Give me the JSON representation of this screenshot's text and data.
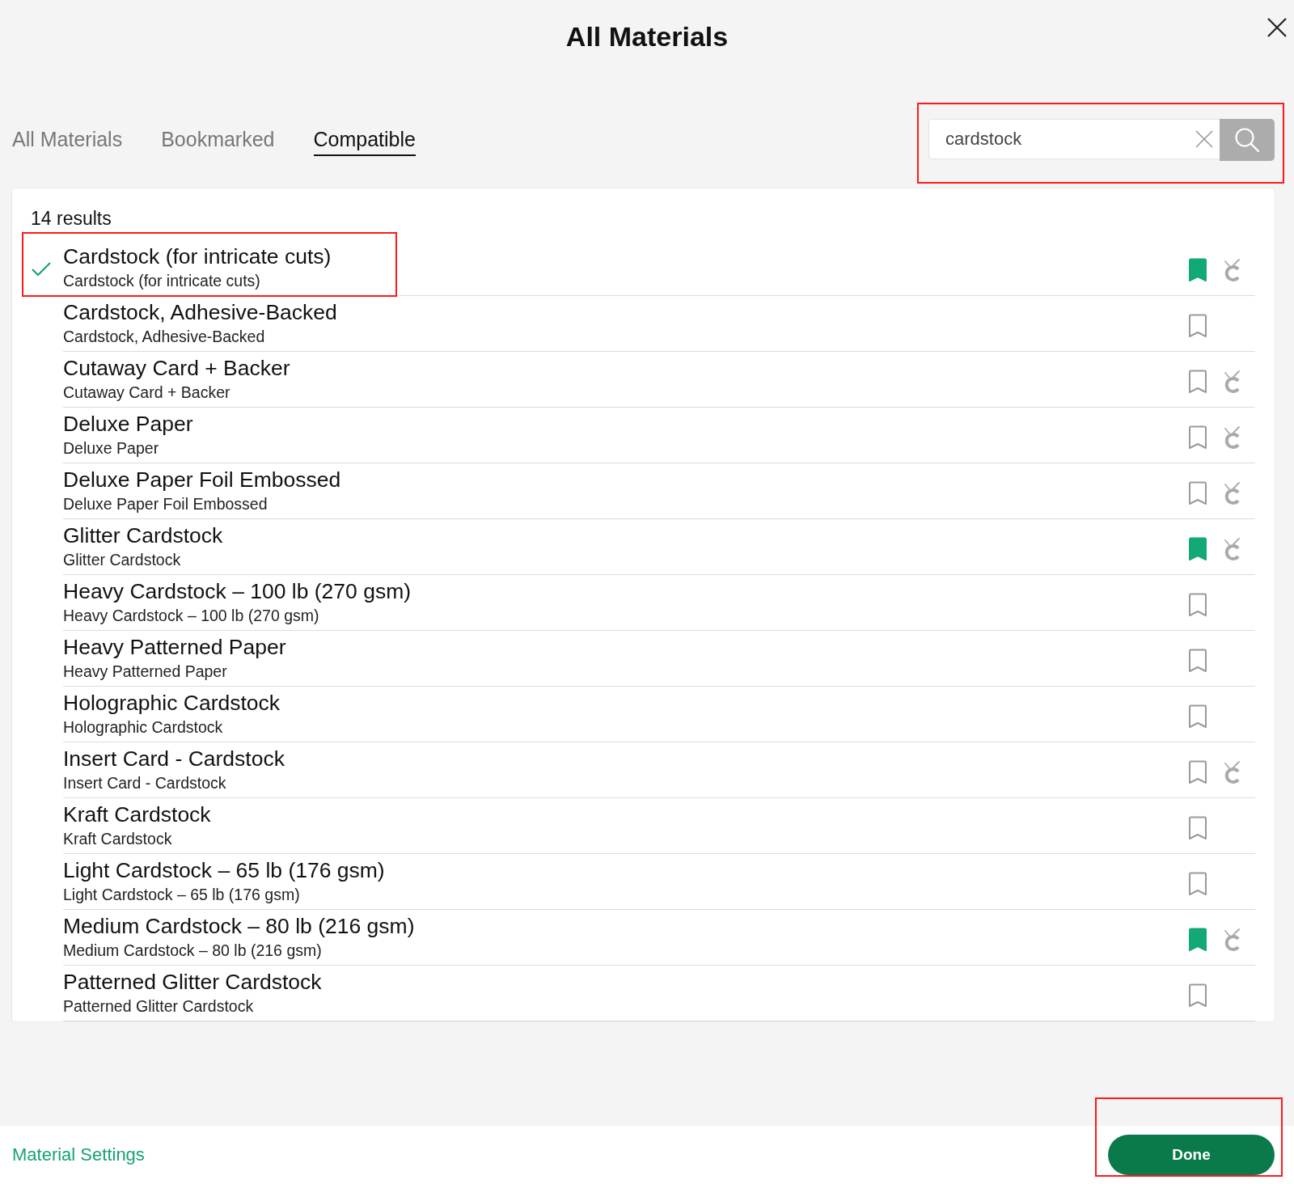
{
  "window": {
    "title": "All Materials"
  },
  "tabs": [
    {
      "label": "All Materials",
      "selected": false
    },
    {
      "label": "Bookmarked",
      "selected": false
    },
    {
      "label": "Compatible",
      "selected": true
    }
  ],
  "search": {
    "value": "cardstock",
    "highlighted": true
  },
  "results_count": "14 results",
  "materials": [
    {
      "title": "Cardstock (for intricate cuts)",
      "subtitle": "Cardstock (for intricate cuts)",
      "selected": true,
      "bookmarked": true,
      "machine_compatible": true,
      "highlighted": true
    },
    {
      "title": "Cardstock, Adhesive-Backed",
      "subtitle": "Cardstock, Adhesive-Backed",
      "selected": false,
      "bookmarked": false,
      "machine_compatible": false,
      "highlighted": false
    },
    {
      "title": "Cutaway Card + Backer",
      "subtitle": "Cutaway Card + Backer",
      "selected": false,
      "bookmarked": false,
      "machine_compatible": true,
      "highlighted": false
    },
    {
      "title": "Deluxe Paper",
      "subtitle": "Deluxe Paper",
      "selected": false,
      "bookmarked": false,
      "machine_compatible": true,
      "highlighted": false
    },
    {
      "title": "Deluxe Paper Foil Embossed",
      "subtitle": "Deluxe Paper Foil Embossed",
      "selected": false,
      "bookmarked": false,
      "machine_compatible": true,
      "highlighted": false
    },
    {
      "title": "Glitter Cardstock",
      "subtitle": "Glitter Cardstock",
      "selected": false,
      "bookmarked": true,
      "machine_compatible": true,
      "highlighted": false
    },
    {
      "title": "Heavy Cardstock – 100 lb (270 gsm)",
      "subtitle": "Heavy Cardstock – 100 lb (270 gsm)",
      "selected": false,
      "bookmarked": false,
      "machine_compatible": false,
      "highlighted": false
    },
    {
      "title": "Heavy Patterned Paper",
      "subtitle": "Heavy Patterned Paper",
      "selected": false,
      "bookmarked": false,
      "machine_compatible": false,
      "highlighted": false
    },
    {
      "title": "Holographic Cardstock",
      "subtitle": "Holographic Cardstock",
      "selected": false,
      "bookmarked": false,
      "machine_compatible": false,
      "highlighted": false
    },
    {
      "title": "Insert Card - Cardstock",
      "subtitle": "Insert Card - Cardstock",
      "selected": false,
      "bookmarked": false,
      "machine_compatible": true,
      "highlighted": false
    },
    {
      "title": "Kraft Cardstock",
      "subtitle": "Kraft Cardstock",
      "selected": false,
      "bookmarked": false,
      "machine_compatible": false,
      "highlighted": false
    },
    {
      "title": "Light Cardstock – 65 lb (176 gsm)",
      "subtitle": "Light Cardstock – 65 lb (176 gsm)",
      "selected": false,
      "bookmarked": false,
      "machine_compatible": false,
      "highlighted": false
    },
    {
      "title": "Medium Cardstock – 80 lb (216 gsm)",
      "subtitle": "Medium Cardstock – 80 lb (216 gsm)",
      "selected": false,
      "bookmarked": true,
      "machine_compatible": true,
      "highlighted": false
    },
    {
      "title": "Patterned Glitter Cardstock",
      "subtitle": "Patterned Glitter Cardstock",
      "selected": false,
      "bookmarked": false,
      "machine_compatible": false,
      "highlighted": false
    }
  ],
  "footer": {
    "link": "Material Settings",
    "done_button": {
      "label": "Done",
      "highlighted": true
    }
  }
}
